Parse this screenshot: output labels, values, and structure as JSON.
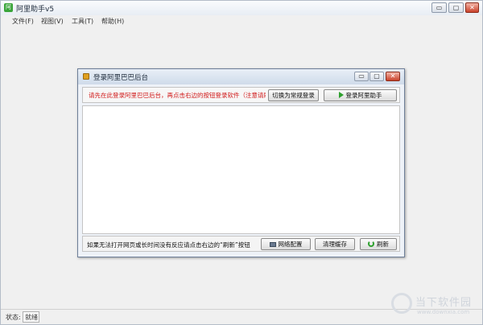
{
  "window": {
    "title": "阿里助手v5",
    "icon_label": "阿",
    "controls": {
      "minimize": "▭",
      "maximize": "▢",
      "close": "✕"
    }
  },
  "menu": [
    {
      "label": "文件(F)"
    },
    {
      "label": "视图(V)"
    },
    {
      "label": "工具(T)"
    },
    {
      "label": "帮助(H)"
    }
  ],
  "dialog": {
    "title": "登录阿里巴巴后台",
    "controls": {
      "minimize": "▭",
      "maximize": "▢",
      "close": "✕"
    },
    "notice": "请先在此登录阿里巴巴后台，再点击右边的按钮登录软件（注意请刷",
    "switch_button": "切换为常规登录",
    "login_button": "登录阿里助手",
    "hint": "如果无法打开网页或长时间没有反应请点击右边的“刷新”按钮",
    "network_button": "网络配置",
    "clear_cache_button": "清理缓存",
    "refresh_button": "刷新"
  },
  "status": {
    "label": "状态:",
    "value": "就绪"
  },
  "watermark": {
    "text": "当下软件园",
    "url": "www.downxia.com"
  },
  "colors": {
    "notice_text": "#d01818",
    "accent_green": "#2ea02e"
  }
}
